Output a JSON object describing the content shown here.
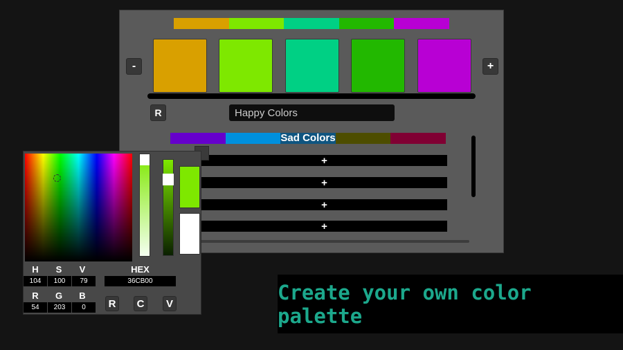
{
  "palette": {
    "name": "Happy Colors",
    "colors": [
      "#D9A000",
      "#7EE800",
      "#00D084",
      "#22B800",
      "#B800D4"
    ],
    "minus_label": "-",
    "plus_label": "+",
    "reset_label": "R"
  },
  "saved_palettes": [
    {
      "name": "Sad Colors",
      "colors": [
        "#6600CC",
        "#0090DD",
        "#0F5580",
        "#4D4D00",
        "#800033"
      ]
    }
  ],
  "empty_slots": [
    {
      "label": "+"
    },
    {
      "label": "+"
    },
    {
      "label": "+"
    },
    {
      "label": "+"
    }
  ],
  "picker": {
    "h_label": "H",
    "s_label": "S",
    "v_label": "V",
    "hex_label": "HEX",
    "r_label": "R",
    "g_label": "G",
    "b_label": "B",
    "h": "104",
    "s": "100",
    "v": "79",
    "hex": "36CB00",
    "r": "54",
    "g": "203",
    "b": "0",
    "saturation": 1.0,
    "value": 0.79,
    "current_color": "#7EE800",
    "previous_color": "#FFFFFF",
    "buttons": [
      "R",
      "C",
      "V"
    ]
  },
  "banner": {
    "text": "Create your own color palette",
    "color": "#1CA88C"
  }
}
